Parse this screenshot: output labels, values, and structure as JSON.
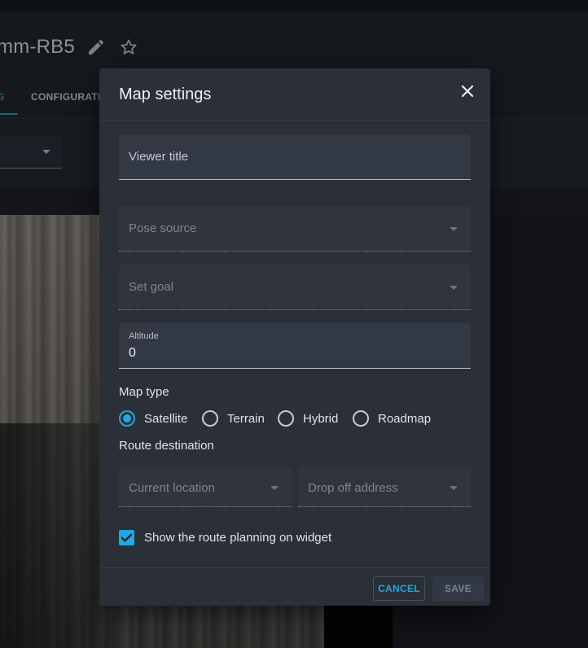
{
  "background": {
    "page_title": "mm-RB5",
    "tabs": [
      {
        "label": "G",
        "active": true
      },
      {
        "label": "CONFIGURATIO",
        "active": false
      }
    ],
    "icons": {
      "edit": "pencil-icon",
      "favorite": "star-outline-icon"
    }
  },
  "dialog": {
    "title": "Map settings",
    "close_icon": "close-icon",
    "viewer_title": {
      "placeholder": "Viewer title",
      "value": ""
    },
    "pose_source": {
      "placeholder": "Pose source",
      "value": ""
    },
    "set_goal": {
      "placeholder": "Set goal",
      "value": ""
    },
    "altitude": {
      "label": "Altitude",
      "value": "0"
    },
    "map_type": {
      "label": "Map type",
      "options": [
        {
          "label": "Satellite",
          "selected": true
        },
        {
          "label": "Terrain",
          "selected": false
        },
        {
          "label": "Hybrid",
          "selected": false
        },
        {
          "label": "Roadmap",
          "selected": false
        }
      ]
    },
    "route_destination": {
      "label": "Route destination",
      "start": {
        "placeholder": "Current location"
      },
      "end": {
        "placeholder": "Drop off address"
      }
    },
    "show_route": {
      "label": "Show the route planning on widget",
      "checked": true
    },
    "footer": {
      "cancel_label": "CANCEL",
      "save_label": "SAVE"
    }
  },
  "colors": {
    "accent": "#22a7e0",
    "dialog_bg": "#2a2f38",
    "page_bg": "#1b1f26",
    "field_bg": "#333944"
  }
}
